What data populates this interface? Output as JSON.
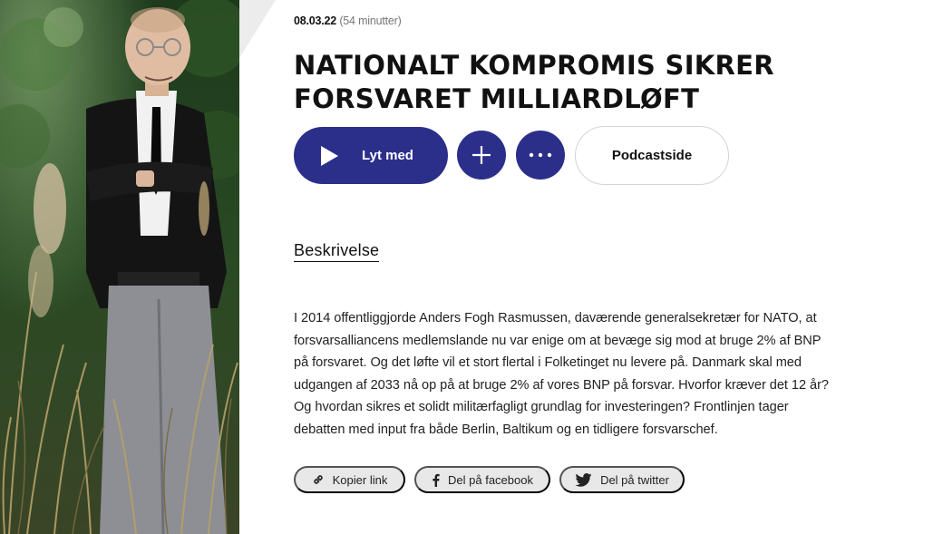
{
  "episode": {
    "date": "08.03.22",
    "duration": "(54 minutter)",
    "title_line1": "NATIONALT KOMPROMIS SIKRER",
    "title_line2": "FORSVARET MILLIARDLØFT"
  },
  "actions": {
    "play_label": "Lyt med",
    "podcast_label": "Podcastside"
  },
  "description": {
    "heading": "Beskrivelse",
    "text": "I 2014 offentliggjorde Anders Fogh Rasmussen, daværende generalsekretær for NATO, at forsvarsalliancens medlemslande nu var enige om at bevæge sig mod at bruge 2% af BNP på forsvaret. Og det løfte vil et stort flertal i Folketinget nu levere på. Danmark skal med udgangen af 2033 nå op på at bruge 2% af vores BNP på forsvar. Hvorfor kræver det 12 år? Og hvordan sikres et solidt militærfagligt grundlag for investeringen? Frontlinjen tager debatten med input fra både Berlin, Baltikum og en tidligere forsvarschef."
  },
  "share": {
    "copy_label": "Kopier link",
    "facebook_label": "Del på facebook",
    "twitter_label": "Del på twitter"
  },
  "icons": {
    "play": "play-icon",
    "add": "plus-icon",
    "more": "more-dots-icon",
    "copy": "link-icon",
    "facebook": "facebook-icon",
    "twitter": "twitter-icon"
  },
  "colors": {
    "accent": "#2b2f8a",
    "share_bg": "#e8e8e8"
  }
}
